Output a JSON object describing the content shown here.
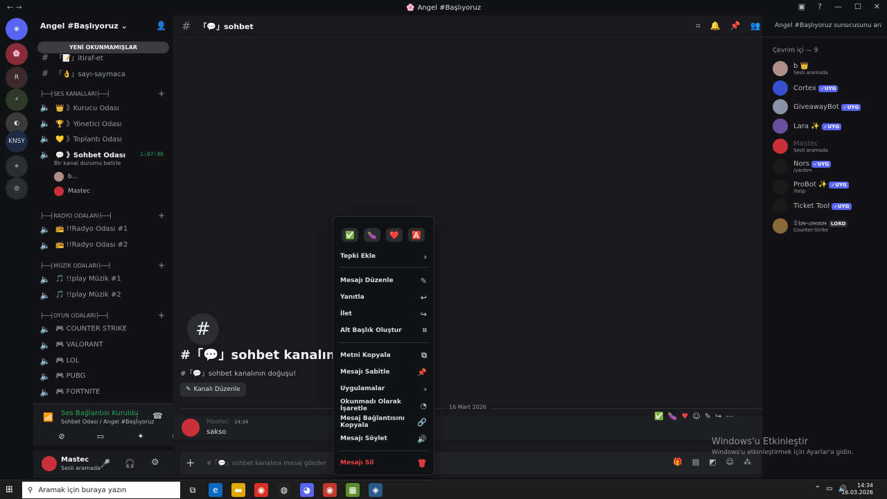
{
  "window": {
    "title": "Angel #Başlıyoruz"
  },
  "server": {
    "name": "Angel #Başlıyoruz",
    "unread_pill": "YENİ OKUNMAMIŞLAR"
  },
  "channels_text": [
    {
      "icon": "#",
      "label": "「📝」itiraf-et"
    },
    {
      "icon": "#",
      "label": "「👌」sayı-saymaca"
    }
  ],
  "categories": {
    "ses": "├──┤SES KANALLARI├──┤",
    "radyo": "├──┤RADYO ODALARI├──┤",
    "muzik": "├──┤MÜZİK ODALARI├──┤",
    "oyun": "├──┤OYUN ODALARI├──┤"
  },
  "voice_channels": [
    {
      "label": "👑 》Kurucu Odası"
    },
    {
      "label": "🏆 》Yönetici Odası"
    },
    {
      "label": "💛 》Toplantı Odası"
    },
    {
      "label": "💬 》Sohbet Odası"
    }
  ],
  "active_voice": {
    "time": "1:07:46",
    "status_hint": "Bir kanal durumu belirle",
    "members": [
      "b...",
      "Mastec"
    ]
  },
  "radio_channels": [
    {
      "label": "📻 !!Radyo Odası #1"
    },
    {
      "label": "📻 !!Radyo Odası #2"
    }
  ],
  "music_channels": [
    {
      "label": "🎵 !!play Müzik #1"
    },
    {
      "label": "🎵 !!play Müzik #2"
    }
  ],
  "game_channels": [
    {
      "label": "🎮 COUNTER STRIKE"
    },
    {
      "label": "🎮 VALORANT"
    },
    {
      "label": "🎮 LOL"
    },
    {
      "label": "🎮 PUBG"
    },
    {
      "label": "🎮 FORTNITE"
    }
  ],
  "voice_panel": {
    "title": "Ses Bağlantısı Kuruldu",
    "sub": "Sohbet Odası / Angel #Başlıyoruz"
  },
  "user_panel": {
    "name": "Mastec",
    "status": "Sesli aramada"
  },
  "channel": {
    "name": "「💬」sohbet",
    "welcome_title": "#「💬」sohbet kanalın",
    "welcome_sub": "#「💬」sohbet kanalının doğuşu!",
    "edit_label": "Kanalı Düzenle",
    "search_placeholder": "Angel #Başlıyoruz sunucusunu ara"
  },
  "date_separator": "16 Mart 2026",
  "message": {
    "author": "Mastec",
    "time": "14:34",
    "text": "sakso"
  },
  "composer": {
    "placeholder": "#「💬」sohbet kanalına mesaj gönder"
  },
  "members": {
    "header": "Çevrim içi — 9",
    "list": [
      {
        "name": "b 👑",
        "status": "Sesli aramada",
        "tag": ""
      },
      {
        "name": "Cortex",
        "status": "",
        "tag": "✓UYG"
      },
      {
        "name": "GiveawayBot",
        "status": "",
        "tag": "✓UYG"
      },
      {
        "name": "Lara ✨",
        "status": "",
        "tag": "✓UYG"
      },
      {
        "name": "Mastec",
        "status": "Sesli aramada",
        "tag": ""
      },
      {
        "name": "Nors",
        "status": "/yardım",
        "tag": "✓UYG"
      },
      {
        "name": "ProBot ✨",
        "status": "/help",
        "tag": "✓UYG"
      },
      {
        "name": "Ticket Tool",
        "status": "",
        "tag": "✓UYG"
      },
      {
        "name": "𝔇𝔦𝔬𝔰-𝔠𝔬𝔰𝔪𝔬𝔰",
        "status": "Counter-Strike",
        "tag": "LORD"
      }
    ]
  },
  "context_menu": {
    "reactions": [
      "✅",
      "🍆",
      "❤️",
      "🅰️"
    ],
    "items": [
      {
        "label": "Tepki Ekle",
        "icon": "›"
      },
      {
        "label": "Mesajı Düzenle",
        "icon": "✎"
      },
      {
        "label": "Yanıtla",
        "icon": "↩"
      },
      {
        "label": "İlet",
        "icon": "↪"
      },
      {
        "label": "Alt Başlık Oluştur",
        "icon": "⌗"
      },
      {
        "label": "Metni Kopyala",
        "icon": "⧉"
      },
      {
        "label": "Mesajı Sabitle",
        "icon": "📌"
      },
      {
        "label": "Uygulamalar",
        "icon": "›"
      },
      {
        "label": "Okunmadı Olarak İşaretle",
        "icon": "◔"
      },
      {
        "label": "Mesaj Bağlantısını Kopyala",
        "icon": "🔗"
      },
      {
        "label": "Mesajı Söylet",
        "icon": "🔊"
      },
      {
        "label": "Mesajı Sil",
        "icon": "🗑"
      }
    ]
  },
  "watermark": {
    "title": "Windows'u Etkinleştir",
    "sub": "Windows'u etkinleştirmek için Ayarlar'a gidin."
  },
  "taskbar": {
    "search": "Aramak için buraya yazın",
    "time": "14:34",
    "date": "16.03.2026"
  }
}
